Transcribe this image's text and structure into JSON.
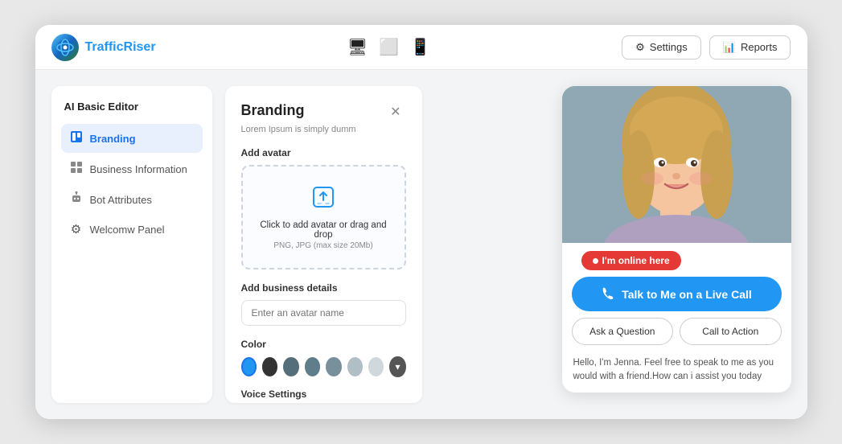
{
  "app": {
    "logo_text_dark": "Traffic",
    "logo_text_accent": "Riser"
  },
  "header": {
    "settings_label": "Settings",
    "reports_label": "Reports",
    "device_icons": [
      "desktop",
      "tablet",
      "mobile"
    ]
  },
  "sidebar": {
    "title": "AI Basic Editor",
    "items": [
      {
        "id": "branding",
        "label": "Branding",
        "icon": "🔷",
        "active": true
      },
      {
        "id": "business",
        "label": "Business Information",
        "icon": "⊞",
        "active": false
      },
      {
        "id": "bot-attributes",
        "label": "Bot Attributes",
        "icon": "🤖",
        "active": false
      },
      {
        "id": "welcome-panel",
        "label": "Welcomw Panel",
        "icon": "⚙️",
        "active": false
      }
    ]
  },
  "branding_panel": {
    "title": "Branding",
    "subtitle": "Lorem Ipsum is simply dumm",
    "add_avatar_label": "Add avatar",
    "dropzone_text": "Click to add avatar or drag and drop",
    "dropzone_hint": "PNG, JPG (max size 20Mb)",
    "business_details_label": "Add business details",
    "avatar_name_placeholder": "Enter an avatar name",
    "color_label": "Color",
    "colors": [
      {
        "hex": "#2196f3",
        "selected": true
      },
      {
        "hex": "#333333",
        "selected": false
      },
      {
        "hex": "#546e7a",
        "selected": false
      },
      {
        "hex": "#607d8b",
        "selected": false
      },
      {
        "hex": "#78909c",
        "selected": false
      },
      {
        "hex": "#b0bec5",
        "selected": false
      },
      {
        "hex": "#cfd8dc",
        "selected": false
      }
    ],
    "voice_settings_label": "Voice Settings"
  },
  "bot_preview": {
    "online_badge": "I'm online here",
    "live_call_btn": "Talk to Me on a Live Call",
    "ask_question_btn": "Ask a Question",
    "call_to_action_btn": "Call to Action",
    "chat_text": "Hello, I'm Jenna. Feel free to speak to me as you would with a friend.How can i assist you today"
  }
}
